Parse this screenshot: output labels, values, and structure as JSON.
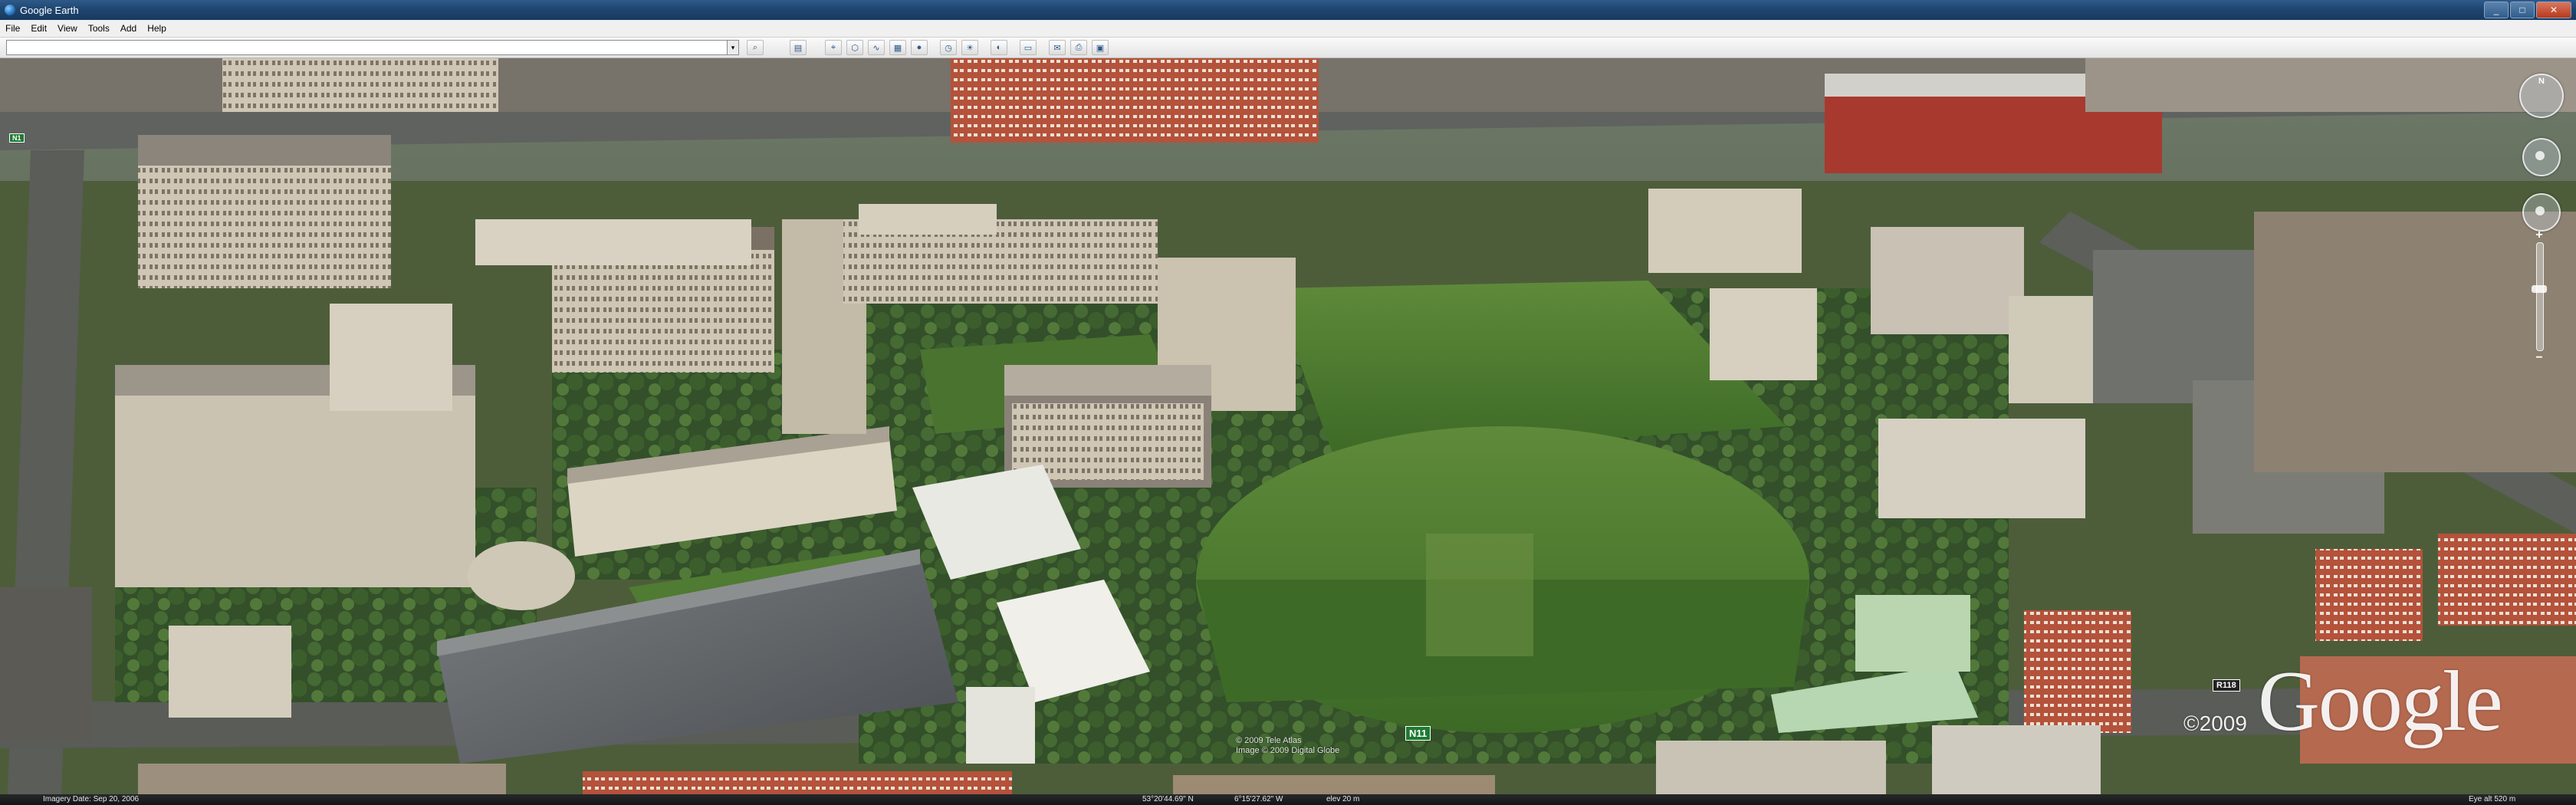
{
  "window": {
    "title": "Google Earth",
    "controls": [
      "_",
      "□",
      "✕"
    ]
  },
  "menu": {
    "items": [
      "File",
      "Edit",
      "View",
      "Tools",
      "Add",
      "Help"
    ]
  },
  "toolbar": {
    "buttons": [
      {
        "name": "search-go-icon",
        "glyph": "⌕"
      },
      {
        "name": "sidebar-icon",
        "glyph": "▤"
      },
      {
        "name": "placemark-icon",
        "glyph": "⌖"
      },
      {
        "name": "polygon-icon",
        "glyph": "⬡"
      },
      {
        "name": "path-icon",
        "glyph": "∿"
      },
      {
        "name": "image-overlay-icon",
        "glyph": "▦"
      },
      {
        "name": "record-tour-icon",
        "glyph": "●"
      },
      {
        "name": "historical-imagery-icon",
        "glyph": "◷"
      },
      {
        "name": "sun-icon",
        "glyph": "☀"
      },
      {
        "name": "planets-icon",
        "glyph": "◐"
      },
      {
        "name": "ruler-icon",
        "glyph": "▭"
      },
      {
        "name": "email-icon",
        "glyph": "✉"
      },
      {
        "name": "print-icon",
        "glyph": "⎙"
      },
      {
        "name": "google-maps-icon",
        "glyph": "▣"
      }
    ]
  },
  "view": {
    "compass_label": "N",
    "zoom_in": "+",
    "zoom_out": "−",
    "copyright_year": "©2009",
    "logo": "Google",
    "data_credit_line1": "© 2009 Tele Atlas",
    "data_credit_line2": "Image © 2009 Digital Globe",
    "road_signs": {
      "n11": "N11",
      "r118": "R118",
      "left": "N1"
    }
  },
  "status": {
    "imagery_date": "Imagery Date: Sep 20, 2006",
    "lat": "53°20'44.69\" N",
    "lon": "6°15'27.62\" W",
    "elev": "elev 20 m",
    "eye_alt": "Eye alt 520 m"
  }
}
